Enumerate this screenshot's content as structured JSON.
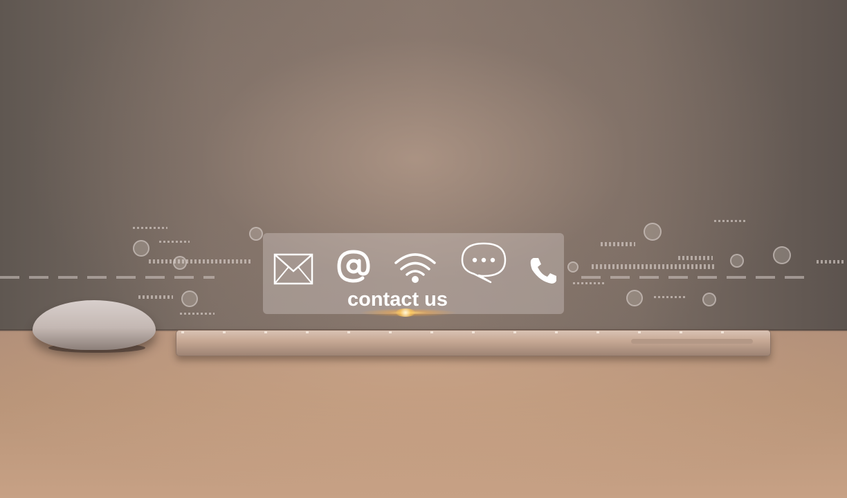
{
  "panel": {
    "heading": "contact us",
    "icons": [
      "envelope-icon",
      "at-sign-icon",
      "wifi-icon",
      "chat-bubble-icon",
      "phone-icon"
    ]
  },
  "colors": {
    "panel_text": "#ffffff",
    "glow": "#ffc85a",
    "wall": "#7d6f66",
    "desk": "#b89478"
  }
}
